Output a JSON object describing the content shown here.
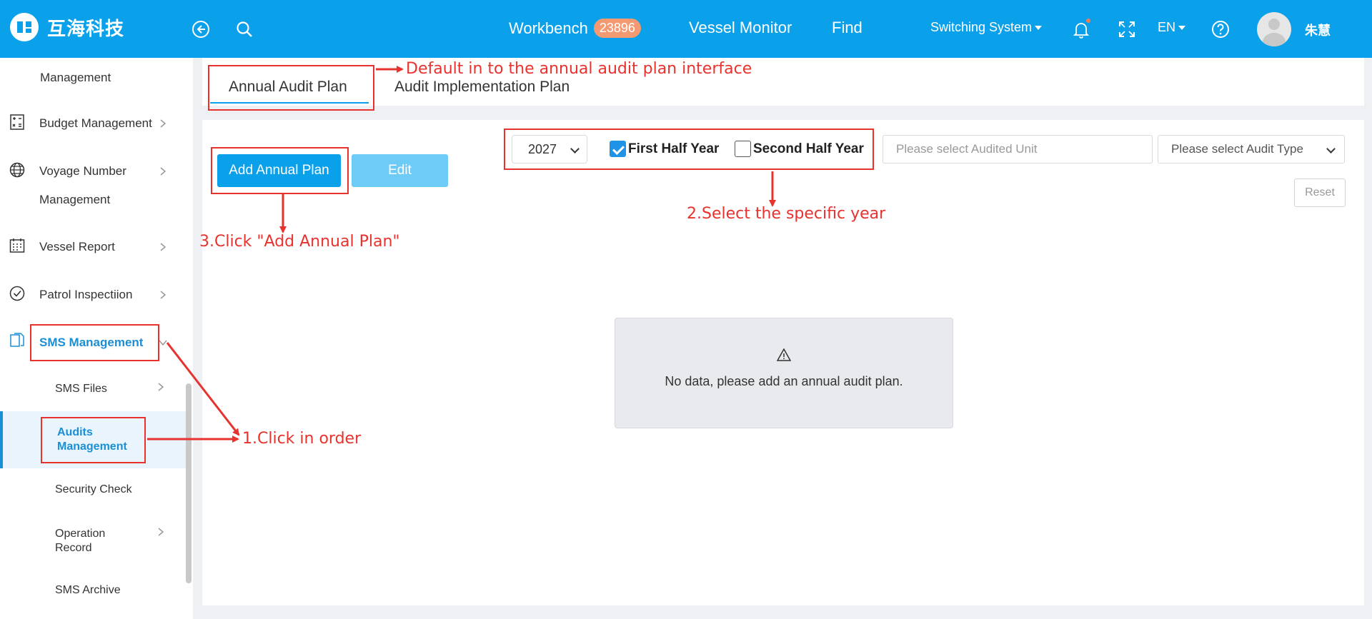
{
  "header": {
    "logo_text": "互海科技",
    "nav": {
      "workbench": "Workbench",
      "workbench_count": "23896",
      "vessel_monitor": "Vessel Monitor",
      "find": "Find"
    },
    "switching_system": "Switching System",
    "language": "EN",
    "user_name": "朱慧"
  },
  "sidebar": {
    "items": [
      {
        "label": "Management"
      },
      {
        "label": "Budget Management"
      },
      {
        "label": "Voyage Number"
      },
      {
        "label": "Management"
      },
      {
        "label": "Vessel Report"
      },
      {
        "label": "Patrol Inspectiion"
      },
      {
        "label": "SMS Management"
      }
    ],
    "sub_items": [
      {
        "label": "SMS Files"
      },
      {
        "label": "Audits"
      },
      {
        "label": "Management"
      },
      {
        "label": "Security Check"
      },
      {
        "label": "Operation"
      },
      {
        "label": "Record"
      },
      {
        "label": "SMS Archive"
      }
    ]
  },
  "tabs": [
    {
      "label": "Annual Audit Plan"
    },
    {
      "label": "Audit Implementation Plan"
    }
  ],
  "toolbar": {
    "add_label": "Add Annual Plan",
    "edit_label": "Edit"
  },
  "filters": {
    "year": "2027",
    "first_half_label": "First Half Year",
    "first_half_checked": true,
    "second_half_label": "Second Half Year",
    "second_half_checked": false,
    "unit_placeholder": "Please select Audited Unit",
    "audit_type_placeholder": "Please select Audit Type",
    "reset_label": "Reset"
  },
  "empty_state": {
    "message": "No data, please add an annual audit plan."
  },
  "annotations": {
    "default_note": "Default in to the annual audit plan interface",
    "step1": "1.Click in order",
    "step2": "2.Select the specific year",
    "step3": "3.Click \"Add Annual Plan\""
  },
  "colors": {
    "primary": "#0aa0ea",
    "annotation": "#e8322e",
    "badge": "#f49a72"
  }
}
